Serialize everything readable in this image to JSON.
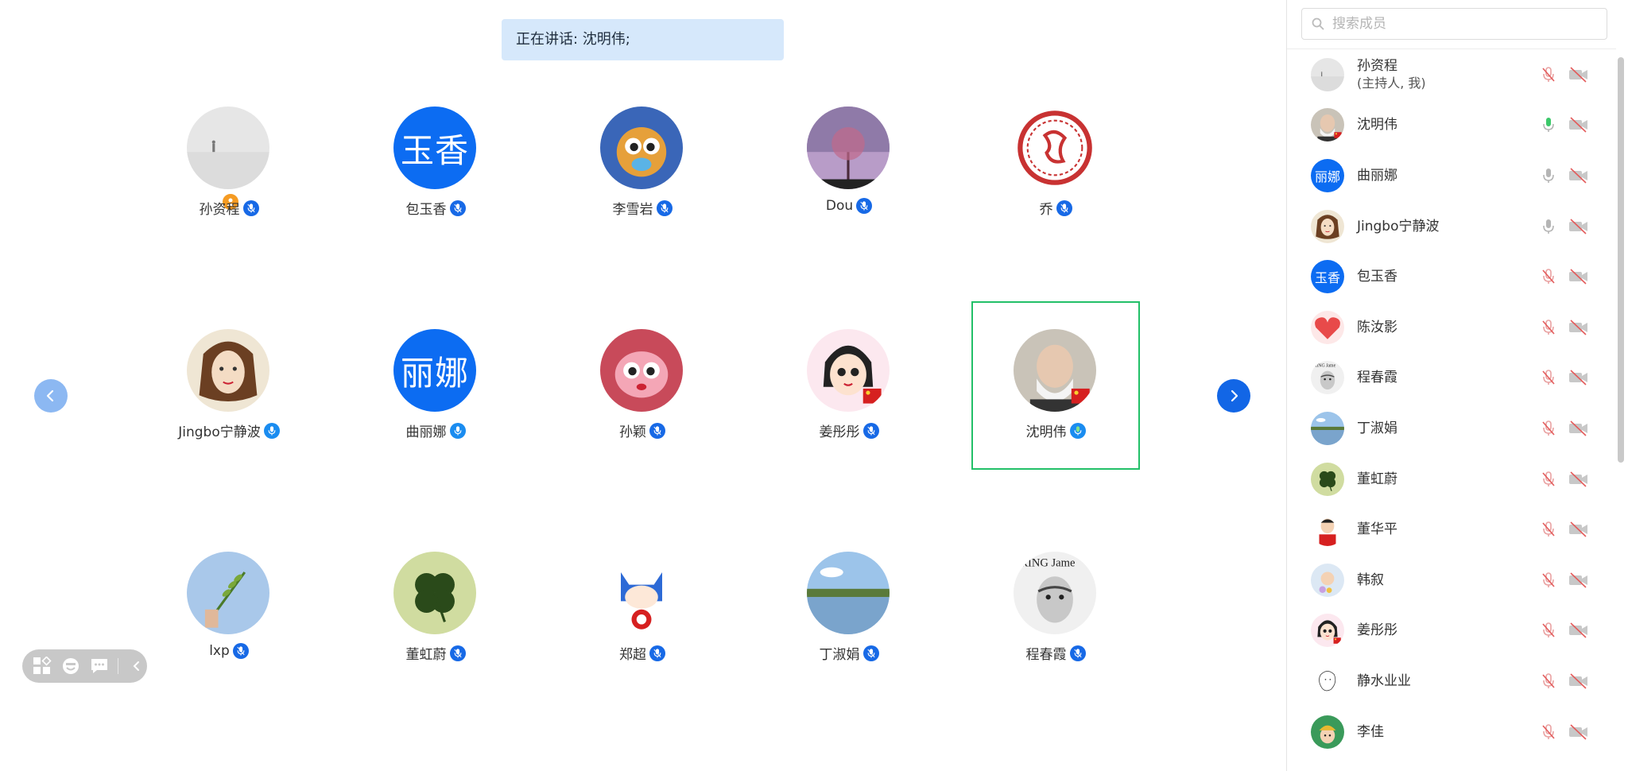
{
  "speaking_banner": "正在讲话: 沈明伟;",
  "grid": {
    "participants": [
      {
        "name": "孙资程",
        "mic": "muted",
        "host": true,
        "avatar": "snow-scene"
      },
      {
        "name": "包玉香",
        "mic": "muted",
        "avatar_text": "玉香"
      },
      {
        "name": "李雪岩",
        "mic": "muted",
        "avatar": "cartoon-fox"
      },
      {
        "name": "Dou",
        "mic": "muted",
        "avatar": "purple-tree"
      },
      {
        "name": "乔",
        "mic": "muted",
        "avatar": "red-seal"
      },
      {
        "name": "Jingbo宁静波",
        "mic": "on",
        "avatar": "drawn-woman"
      },
      {
        "name": "曲丽娜",
        "mic": "on",
        "avatar_text": "丽娜"
      },
      {
        "name": "孙颖",
        "mic": "muted",
        "avatar": "pink-rabbit"
      },
      {
        "name": "姜彤彤",
        "mic": "muted",
        "avatar": "cartoon-girl"
      },
      {
        "name": "沈明伟",
        "mic": "speaking",
        "avatar": "old-man-photo",
        "selected": true
      },
      {
        "name": "lxp",
        "mic": "muted",
        "avatar": "plant-hand"
      },
      {
        "name": "董虹蔚",
        "mic": "muted",
        "avatar": "clover"
      },
      {
        "name": "郑超",
        "mic": "muted",
        "avatar": "captain-cat"
      },
      {
        "name": "丁淑娟",
        "mic": "muted",
        "avatar": "lake"
      },
      {
        "name": "程春霞",
        "mic": "muted",
        "avatar": "sketch-portrait"
      }
    ]
  },
  "toolbar": {
    "icons": [
      "layout-icon",
      "emoji-icon",
      "chat-icon",
      "collapse-icon"
    ]
  },
  "sidebar": {
    "search_placeholder": "搜索成员",
    "members": [
      {
        "name": "孙资程",
        "role": "(主持人, 我)",
        "mic": "muted",
        "avatar": "snow-scene"
      },
      {
        "name": "沈明伟",
        "mic": "speaking",
        "avatar": "old-man-photo"
      },
      {
        "name": "曲丽娜",
        "mic": "on",
        "avatar_text": "丽娜"
      },
      {
        "name": "Jingbo宁静波",
        "mic": "on",
        "avatar": "drawn-woman"
      },
      {
        "name": "包玉香",
        "mic": "muted",
        "avatar_text": "玉香"
      },
      {
        "name": "陈汝影",
        "mic": "muted",
        "avatar": "red-heart"
      },
      {
        "name": "程春霞",
        "mic": "muted",
        "avatar": "sketch-portrait"
      },
      {
        "name": "丁淑娟",
        "mic": "muted",
        "avatar": "lake"
      },
      {
        "name": "董虹蔚",
        "mic": "muted",
        "avatar": "clover"
      },
      {
        "name": "董华平",
        "mic": "muted",
        "avatar": "boy-photo"
      },
      {
        "name": "韩叙",
        "mic": "muted",
        "avatar": "flower-kid"
      },
      {
        "name": "姜彤彤",
        "mic": "muted",
        "avatar": "cartoon-girl"
      },
      {
        "name": "静水业业",
        "mic": "muted",
        "avatar": "line-drawing"
      },
      {
        "name": "李佳",
        "mic": "muted",
        "avatar": "kid-hat"
      }
    ]
  },
  "colors": {
    "accent": "#1266e6",
    "speaking_green": "#22c068",
    "muted_red": "#e35b5b",
    "banner_bg": "#d6e8fb"
  }
}
